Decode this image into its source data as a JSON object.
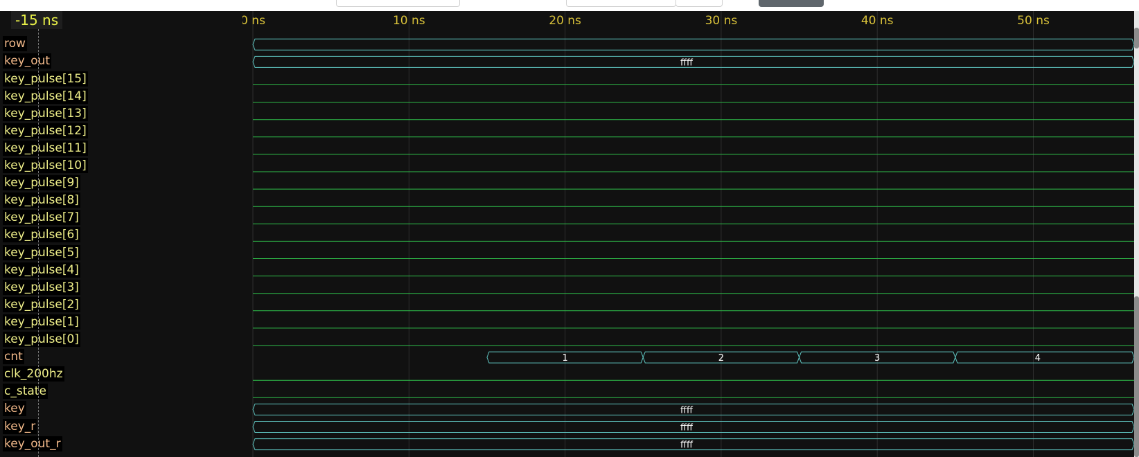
{
  "cursor": {
    "time_label": "-15 ns"
  },
  "timeline": {
    "ticks": [
      {
        "t": 0,
        "label": "0 ns"
      },
      {
        "t": 10,
        "label": "10 ns"
      },
      {
        "t": 20,
        "label": "20 ns"
      },
      {
        "t": 30,
        "label": "30 ns"
      },
      {
        "t": 40,
        "label": "40 ns"
      },
      {
        "t": 50,
        "label": "50 ns"
      }
    ]
  },
  "signals": [
    {
      "name": "row",
      "kind": "bus",
      "segments": [
        {
          "from": 0,
          "to": 60,
          "value": ""
        }
      ]
    },
    {
      "name": "key_out",
      "kind": "bus",
      "segments": [
        {
          "from": 0,
          "to": 60,
          "value": "ffff"
        }
      ]
    },
    {
      "name": "key_pulse[15]",
      "kind": "bit"
    },
    {
      "name": "key_pulse[14]",
      "kind": "bit"
    },
    {
      "name": "key_pulse[13]",
      "kind": "bit"
    },
    {
      "name": "key_pulse[12]",
      "kind": "bit"
    },
    {
      "name": "key_pulse[11]",
      "kind": "bit"
    },
    {
      "name": "key_pulse[10]",
      "kind": "bit"
    },
    {
      "name": "key_pulse[9]",
      "kind": "bit"
    },
    {
      "name": "key_pulse[8]",
      "kind": "bit"
    },
    {
      "name": "key_pulse[7]",
      "kind": "bit"
    },
    {
      "name": "key_pulse[6]",
      "kind": "bit"
    },
    {
      "name": "key_pulse[5]",
      "kind": "bit"
    },
    {
      "name": "key_pulse[4]",
      "kind": "bit"
    },
    {
      "name": "key_pulse[3]",
      "kind": "bit"
    },
    {
      "name": "key_pulse[2]",
      "kind": "bit"
    },
    {
      "name": "key_pulse[1]",
      "kind": "bit"
    },
    {
      "name": "key_pulse[0]",
      "kind": "bit"
    },
    {
      "name": "cnt",
      "kind": "bus",
      "segments": [
        {
          "from": 15,
          "to": 25,
          "value": "1"
        },
        {
          "from": 25,
          "to": 35,
          "value": "2"
        },
        {
          "from": 35,
          "to": 45,
          "value": "3"
        },
        {
          "from": 45,
          "to": 60,
          "value": "4"
        }
      ]
    },
    {
      "name": "clk_200hz",
      "kind": "bit"
    },
    {
      "name": "c_state",
      "kind": "bit"
    },
    {
      "name": "key",
      "kind": "bus",
      "segments": [
        {
          "from": 0,
          "to": 60,
          "value": "ffff"
        }
      ]
    },
    {
      "name": "key_r",
      "kind": "bus",
      "segments": [
        {
          "from": 0,
          "to": 60,
          "value": "ffff"
        }
      ]
    },
    {
      "name": "key_out_r",
      "kind": "bus",
      "segments": [
        {
          "from": 0,
          "to": 60,
          "value": "ffff"
        }
      ]
    }
  ],
  "colors": {
    "background": "#111111",
    "grid": "#2e2e2e",
    "wave_bit": "#2fbf4a",
    "wave_bus": "#5fc4c0",
    "value_text": "#ffffff",
    "bus_name": "#f2b98a",
    "bit_name": "#f0f08a",
    "tick_label": "#d9c23a",
    "cursor_text": "#e8f048"
  }
}
